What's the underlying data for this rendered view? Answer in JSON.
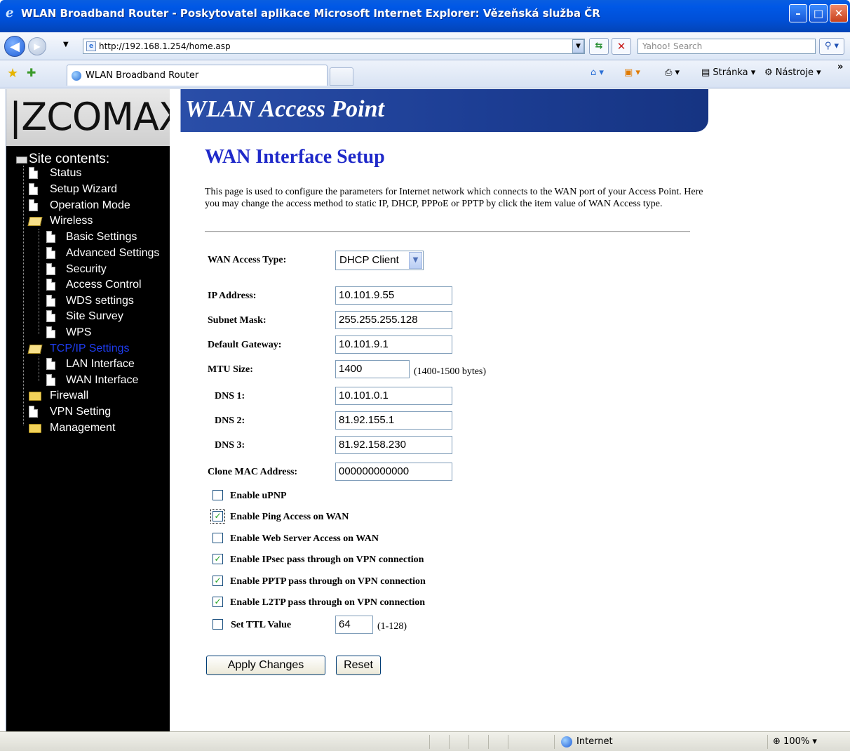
{
  "window": {
    "title": "WLAN Broadband Router - Poskytovatel aplikace Microsoft Internet Explorer: Vězeňská služba ČR",
    "minimize": "–",
    "maximize": "□",
    "close": "✕"
  },
  "browser": {
    "url": "http://192.168.1.254/home.asp",
    "search_placeholder": "Yahoo! Search",
    "tab_title": "WLAN Broadband Router",
    "page_menu": "Stránka",
    "tools_menu": "Nástroje",
    "overflow": "»"
  },
  "header": {
    "logo": "ZCOMAX",
    "banner_title": "WLAN Access Point"
  },
  "sidebar": {
    "heading": "Site contents:",
    "items": [
      {
        "label": "Status"
      },
      {
        "label": "Setup Wizard"
      },
      {
        "label": "Operation Mode"
      },
      {
        "label": "Wireless"
      },
      {
        "label": "Basic Settings"
      },
      {
        "label": "Advanced Settings"
      },
      {
        "label": "Security"
      },
      {
        "label": "Access Control"
      },
      {
        "label": "WDS settings"
      },
      {
        "label": "Site Survey"
      },
      {
        "label": "WPS"
      },
      {
        "label": "TCP/IP Settings"
      },
      {
        "label": "LAN Interface"
      },
      {
        "label": "WAN Interface"
      },
      {
        "label": "Firewall"
      },
      {
        "label": "VPN Setting"
      },
      {
        "label": "Management"
      }
    ]
  },
  "main": {
    "title": "WAN Interface Setup",
    "description": "This page is used to configure the parameters for Internet network which connects to the WAN port of your Access Point. Here you may change the access method to static IP, DHCP, PPPoE or PPTP by click the item value of WAN Access type.",
    "fields": {
      "wan_access_type_label": "WAN Access Type:",
      "wan_access_type_value": "DHCP Client",
      "ip_label": "IP Address:",
      "ip_value": "10.101.9.55",
      "subnet_label": "Subnet Mask:",
      "subnet_value": "255.255.255.128",
      "gateway_label": "Default Gateway:",
      "gateway_value": "10.101.9.1",
      "mtu_label": "MTU Size:",
      "mtu_value": "1400",
      "mtu_hint": "(1400-1500 bytes)",
      "dns1_label": "DNS 1:",
      "dns1_value": "10.101.0.1",
      "dns2_label": "DNS 2:",
      "dns2_value": "81.92.155.1",
      "dns3_label": "DNS 3:",
      "dns3_value": "81.92.158.230",
      "mac_label": "Clone MAC Address:",
      "mac_value": "000000000000",
      "ttl_value": "64",
      "ttl_hint": "(1-128)"
    },
    "checkboxes": [
      {
        "label": "Enable uPNP",
        "checked": false
      },
      {
        "label": "Enable Ping Access on WAN",
        "checked": true
      },
      {
        "label": "Enable Web Server Access on WAN",
        "checked": false
      },
      {
        "label": "Enable IPsec pass through on VPN connection",
        "checked": true
      },
      {
        "label": "Enable PPTP pass through on VPN connection",
        "checked": true
      },
      {
        "label": "Enable L2TP pass through on VPN connection",
        "checked": true
      },
      {
        "label": "Set TTL Value",
        "checked": false
      }
    ],
    "apply_button": "Apply Changes",
    "reset_button": "Reset"
  },
  "statusbar": {
    "zone": "Internet",
    "zoom": "100%"
  },
  "colors": {
    "title_bar": "#0054e3",
    "banner": "#1c3d93",
    "page_title": "#1f29c9",
    "active_nav": "#1e3cf0",
    "sidebar_bg": "#000000"
  }
}
